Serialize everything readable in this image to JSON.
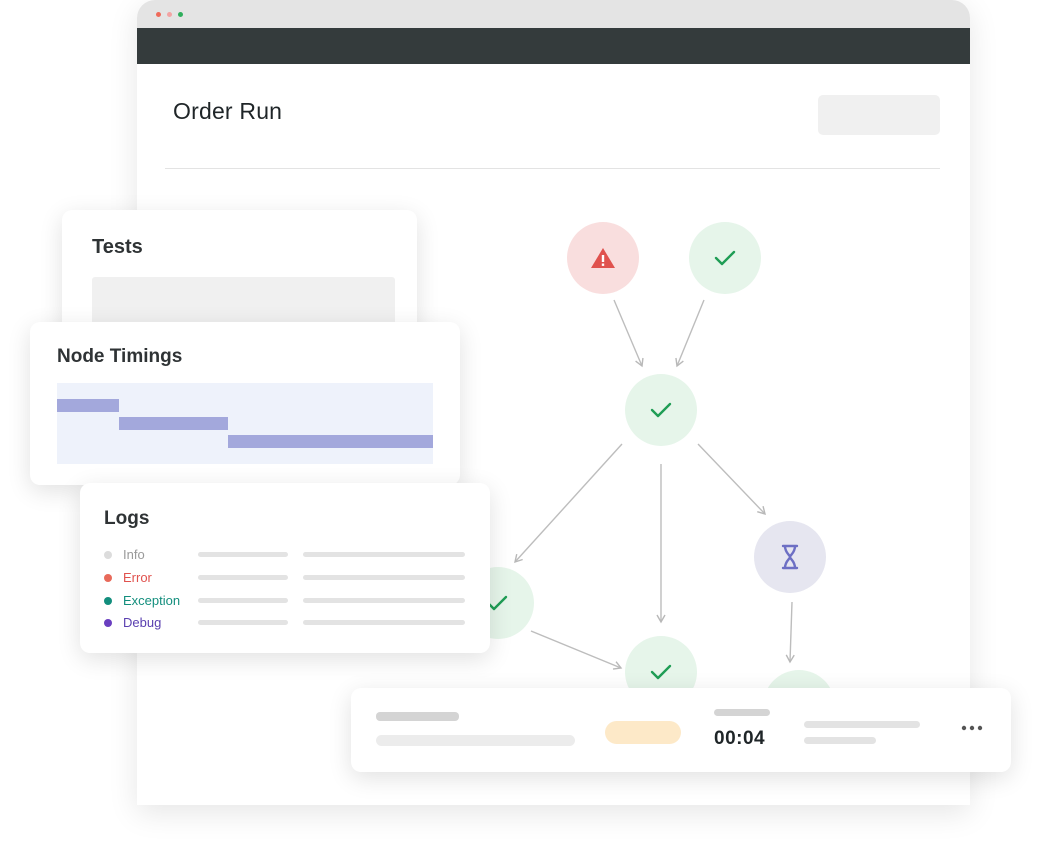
{
  "window": {
    "controls": [
      {
        "name": "close-dot",
        "color": "#ef6a5a"
      },
      {
        "name": "minimize-dot",
        "color": "#f3a3a3"
      },
      {
        "name": "maximize-dot",
        "color": "#2fae5c"
      }
    ]
  },
  "page": {
    "title": "Order Run"
  },
  "graph": {
    "nodes": [
      {
        "id": "warning-node",
        "status": "error",
        "icon": "warning-icon",
        "fill": "#f9dede",
        "icon_color": "#e0524e"
      },
      {
        "id": "success-node-1",
        "status": "success",
        "icon": "check-icon",
        "fill": "#e6f5ea",
        "icon_color": "#1f9d55"
      },
      {
        "id": "success-node-2",
        "status": "success",
        "icon": "check-icon",
        "fill": "#e6f5ea",
        "icon_color": "#1f9d55"
      },
      {
        "id": "success-node-3",
        "status": "success",
        "icon": "check-icon",
        "fill": "#e6f5ea",
        "icon_color": "#1f9d55"
      },
      {
        "id": "success-node-4",
        "status": "success",
        "icon": "check-icon",
        "fill": "#e6f5ea",
        "icon_color": "#1f9d55"
      },
      {
        "id": "pending-node",
        "status": "pending",
        "icon": "hourglass-icon",
        "fill": "#e6e6f0",
        "icon_color": "#6d6fc4"
      },
      {
        "id": "partial-node",
        "status": "success",
        "icon": "",
        "fill": "#e6f5ea",
        "icon_color": "#1f9d55"
      }
    ]
  },
  "tests": {
    "title": "Tests"
  },
  "timings": {
    "title": "Node Timings",
    "bar_color": "#a3a8dc",
    "bg_color": "#eef2fb",
    "spans": [
      {
        "start": 0.0,
        "end": 0.165
      },
      {
        "start": 0.165,
        "end": 0.455
      },
      {
        "start": 0.455,
        "end": 1.0
      }
    ]
  },
  "logs": {
    "title": "Logs",
    "levels": [
      {
        "label": "Info",
        "color": "#9a9a9a",
        "dot": "#dcdcdc"
      },
      {
        "label": "Error",
        "color": "#e0524e",
        "dot": "#e86a5a"
      },
      {
        "label": "Exception",
        "color": "#138e7d",
        "dot": "#138e7d"
      },
      {
        "label": "Debug",
        "color": "#5a3fb0",
        "dot": "#6a3fc0"
      }
    ]
  },
  "run_bar": {
    "status_color": "#fde9c8",
    "duration": "00:04",
    "more_icon": "more-horizontal-icon"
  }
}
